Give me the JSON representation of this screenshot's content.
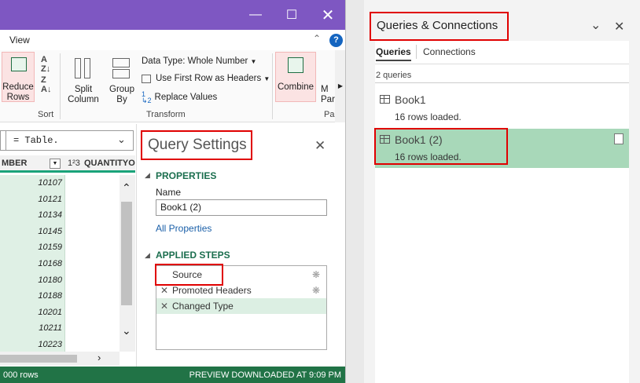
{
  "pq_window": {
    "ribbon_tab": "View",
    "ribbon": {
      "reduce_rows": "Reduce Rows",
      "sort_group": "Sort",
      "split_column": "Split Column",
      "group_by": "Group By",
      "data_type": "Data Type: Whole Number",
      "use_first_row": "Use First Row as Headers",
      "replace_values": "Replace Values",
      "transform_group": "Transform",
      "combine": "Combine",
      "combine_group": "",
      "param_fragment_1": "M",
      "param_fragment_2": "Para",
      "param_group_fragment": "Pa"
    },
    "formula_bar": "= Table.",
    "grid": {
      "col1_header": "MBER",
      "col2_type": "1²3",
      "col2_header": "QUANTITYO",
      "values": [
        "10107",
        "10121",
        "10134",
        "10145",
        "10159",
        "10168",
        "10180",
        "10188",
        "10201",
        "10211",
        "10223"
      ]
    },
    "status_left": "000 rows",
    "status_right": "PREVIEW DOWNLOADED AT 9:09 PM"
  },
  "query_settings": {
    "title": "Query Settings",
    "properties_heading": "PROPERTIES",
    "name_label": "Name",
    "name_value": "Book1 (2)",
    "all_properties": "All Properties",
    "applied_steps_heading": "APPLIED STEPS",
    "steps": [
      "Source",
      "Promoted Headers",
      "Changed Type"
    ]
  },
  "qc_pane": {
    "title": "Queries & Connections",
    "tabs": [
      "Queries",
      "Connections"
    ],
    "count": "2 queries",
    "items": [
      {
        "name": "Book1",
        "status": "16 rows loaded."
      },
      {
        "name": "Book1 (2)",
        "status": "16 rows loaded."
      }
    ]
  },
  "colors": {
    "titlebar": "#7e57c2",
    "accent_green": "#217346",
    "selection_green": "#a8d8b9",
    "highlight_red": "#e00000"
  }
}
